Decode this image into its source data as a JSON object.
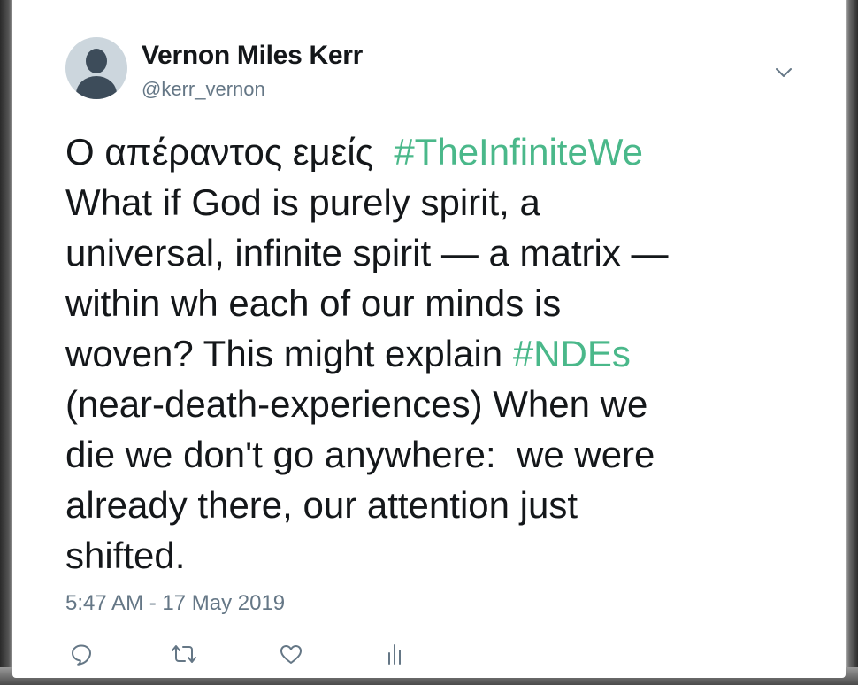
{
  "tweet": {
    "author_name": "Vernon Miles Kerr",
    "author_handle": "@kerr_vernon",
    "text_segments": [
      {
        "text": "Ο απέραντος εμείς  ",
        "hashtag": false
      },
      {
        "text": "#TheInfiniteWe",
        "hashtag": true
      },
      {
        "text": "\nWhat if God is purely spirit, a\nuniversal, infinite spirit — a matrix —\nwithin wh each of our minds is\nwoven? This might explain ",
        "hashtag": false
      },
      {
        "text": "#NDEs",
        "hashtag": true
      },
      {
        "text": "\n(near-death-experiences) When we\ndie we don't go anywhere:  we were\nalready there, our attention just\nshifted.",
        "hashtag": false
      }
    ],
    "timestamp": "5:47 AM - 17 May 2019"
  },
  "icons": {
    "menu": "chevron-down-icon",
    "reply": "reply-icon",
    "retweet": "retweet-icon",
    "like": "heart-icon",
    "analytics": "analytics-icon"
  },
  "colors": {
    "hashtag": "#4ab88a",
    "text": "#14171a",
    "secondary": "#657786",
    "icon": "#657786",
    "avatar_bg": "#ccd6dd",
    "avatar_fg": "#3d4c5a"
  }
}
